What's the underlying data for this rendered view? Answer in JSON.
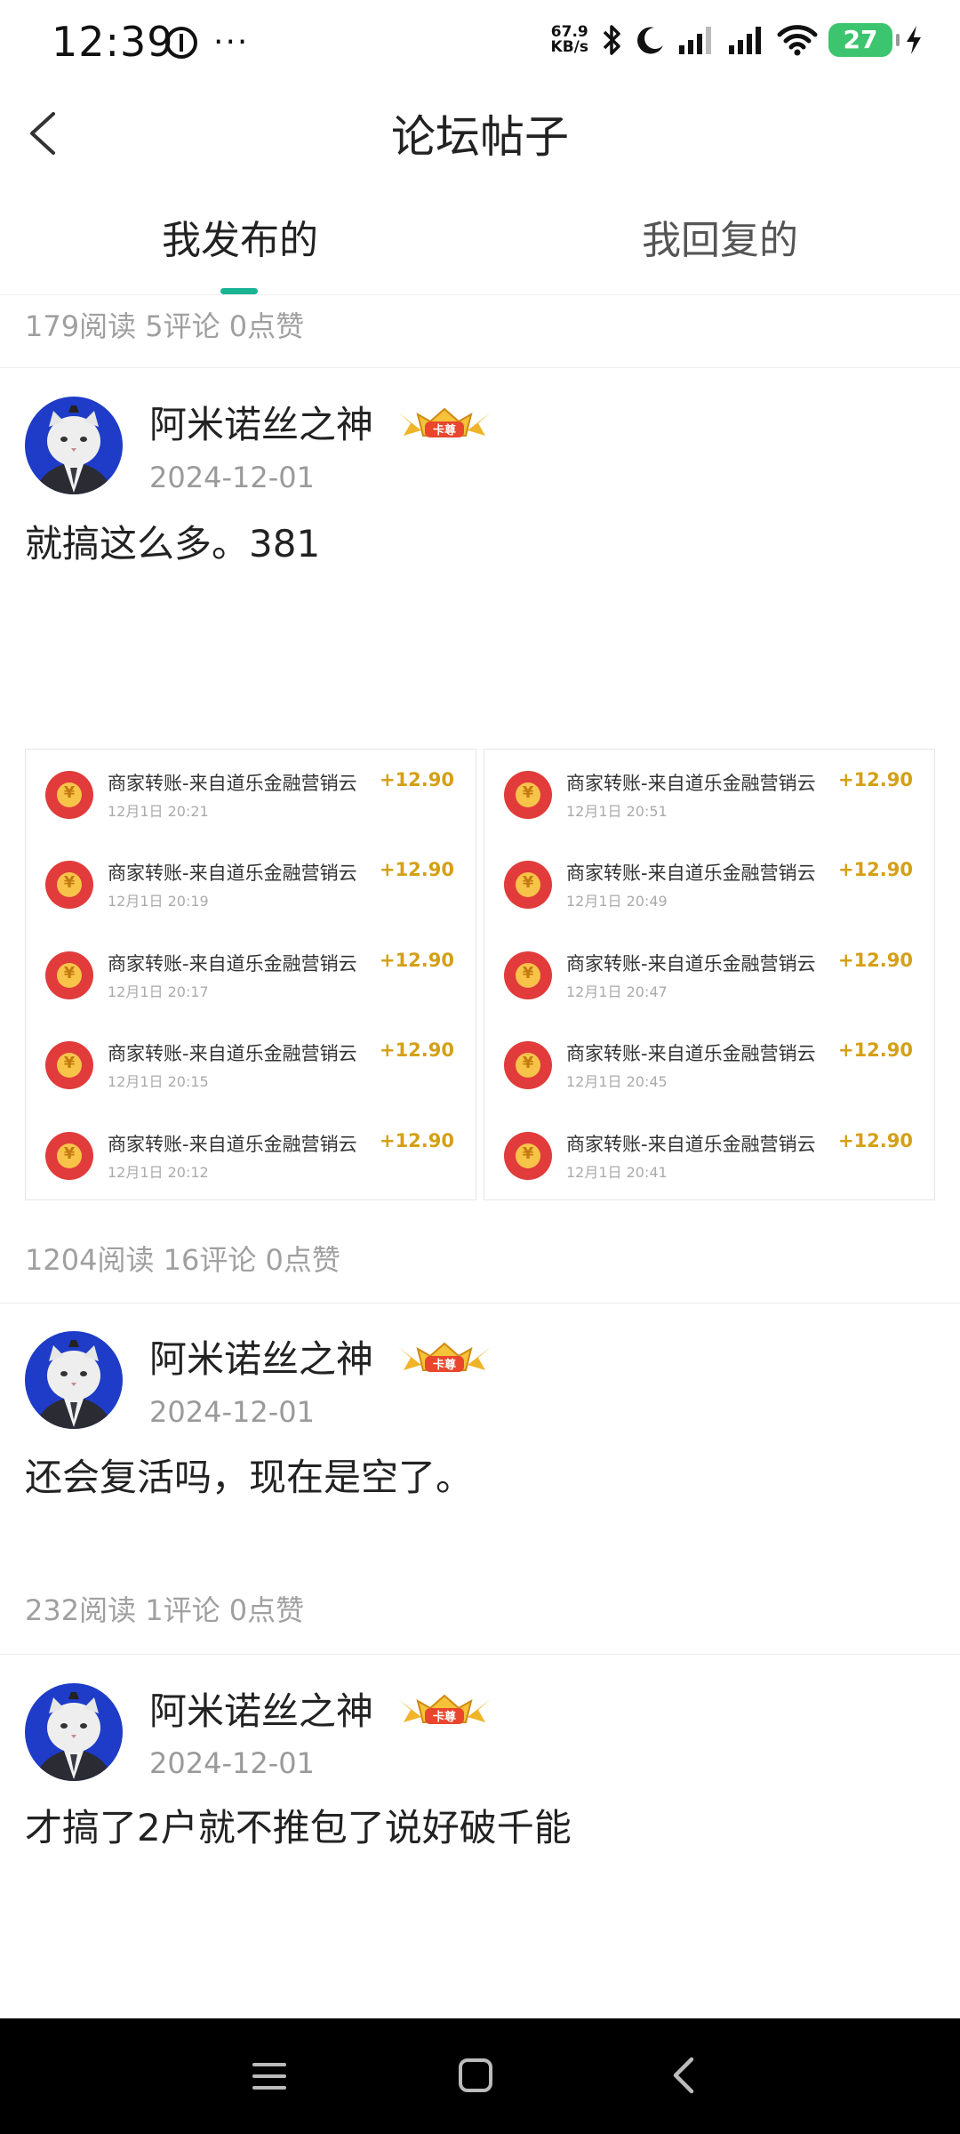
{
  "status_bar": {
    "time": "12:39",
    "more": "···",
    "net_speed_value": "67.9",
    "net_speed_unit": "KB/s",
    "battery": "27"
  },
  "header": {
    "title": "论坛帖子"
  },
  "tabs": [
    {
      "label": "我发布的",
      "active": true
    },
    {
      "label": "我回复的",
      "active": false
    }
  ],
  "top_stats": "179阅读 5评论 0点赞",
  "posts": [
    {
      "username": "阿米诺丝之神",
      "badge": "卡尊",
      "date": "2024-12-01",
      "text": "就搞这么多。381",
      "stats": "1204阅读 16评论 0点赞",
      "payments": {
        "left": [
          {
            "title": "商家转账-来自道乐金融营销云",
            "time": "12月1日 20:21",
            "amount": "+12.90"
          },
          {
            "title": "商家转账-来自道乐金融营销云",
            "time": "12月1日 20:19",
            "amount": "+12.90"
          },
          {
            "title": "商家转账-来自道乐金融营销云",
            "time": "12月1日 20:17",
            "amount": "+12.90"
          },
          {
            "title": "商家转账-来自道乐金融营销云",
            "time": "12月1日 20:15",
            "amount": "+12.90"
          },
          {
            "title": "商家转账-来自道乐金融营销云",
            "time": "12月1日 20:12",
            "amount": "+12.90"
          }
        ],
        "right": [
          {
            "title": "商家转账-来自道乐金融营销云",
            "time": "12月1日 20:51",
            "amount": "+12.90"
          },
          {
            "title": "商家转账-来自道乐金融营销云",
            "time": "12月1日 20:49",
            "amount": "+12.90"
          },
          {
            "title": "商家转账-来自道乐金融营销云",
            "time": "12月1日 20:47",
            "amount": "+12.90"
          },
          {
            "title": "商家转账-来自道乐金融营销云",
            "time": "12月1日 20:45",
            "amount": "+12.90"
          },
          {
            "title": "商家转账-来自道乐金融营销云",
            "time": "12月1日 20:41",
            "amount": "+12.90"
          }
        ]
      }
    },
    {
      "username": "阿米诺丝之神",
      "badge": "卡尊",
      "date": "2024-12-01",
      "text": "还会复活吗，现在是空了。",
      "stats": "232阅读 1评论 0点赞"
    },
    {
      "username": "阿米诺丝之神",
      "badge": "卡尊",
      "date": "2024-12-01",
      "text": "才搞了2户就不推包了说好破千能"
    }
  ],
  "colors": {
    "accent": "#1ab394",
    "amount": "#d4a017",
    "battery": "#3cc56e",
    "muted": "#a0a0a0"
  },
  "icons": {
    "back": "chevron-left-icon",
    "nav_menu": "menu-icon",
    "nav_home": "home-square-icon",
    "nav_back": "back-triangle-icon"
  }
}
